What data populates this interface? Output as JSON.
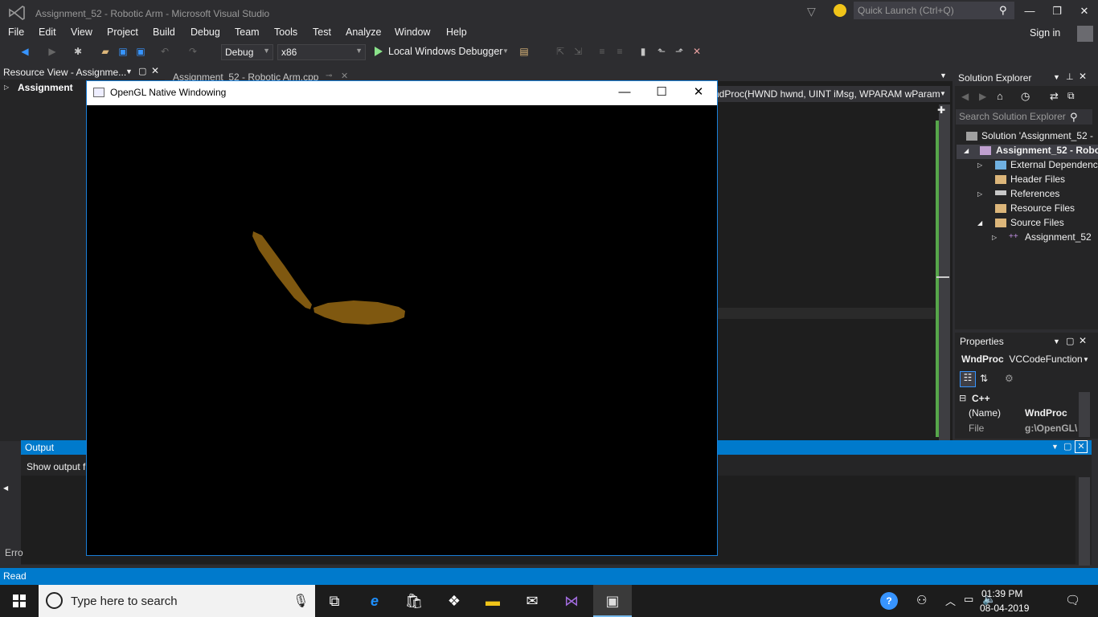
{
  "window": {
    "title": "Assignment_52 - Robotic Arm - Microsoft Visual Studio"
  },
  "quick_launch": {
    "placeholder": "Quick Launch (Ctrl+Q)"
  },
  "menu": [
    "File",
    "Edit",
    "View",
    "Project",
    "Build",
    "Debug",
    "Team",
    "Tools",
    "Test",
    "Analyze",
    "Window",
    "Help"
  ],
  "sign_in": "Sign in",
  "toolbar": {
    "config": "Debug",
    "platform": "x86",
    "debugger": "Local Windows Debugger"
  },
  "resource_view": {
    "title": "Resource View - Assignme...",
    "node": "Assignment"
  },
  "doc_tab": {
    "label": "Assignment_52 - Robotic Arm.cpp"
  },
  "nav_combo": "ndProc(HWND hwnd, UINT iMsg, WPARAM wParam",
  "solution_explorer": {
    "title": "Solution Explorer",
    "search_placeholder": "Search Solution Explorer",
    "items": [
      "Solution 'Assignment_52 -",
      "Assignment_52 - Robo",
      "External Dependenc",
      "Header Files",
      "References",
      "Resource Files",
      "Source Files",
      "Assignment_52"
    ]
  },
  "properties": {
    "title": "Properties",
    "object": "WndProc",
    "object_type": "VCCodeFunction",
    "section": "C++",
    "rows": [
      {
        "name": "(Name)",
        "value": "WndProc"
      },
      {
        "name": "File",
        "value": "g:\\OpenGL\\"
      }
    ]
  },
  "output": {
    "title": "Output",
    "show_output": "Show output f"
  },
  "error_list_label": "Erro",
  "status": "Read",
  "gl_window": {
    "title": "OpenGL Native Windowing"
  },
  "taskbar": {
    "search": "Type here to search",
    "time": "01:39 PM",
    "date": "08-04-2019"
  },
  "colors": {
    "arm": "#7f5810",
    "accent": "#007acc"
  }
}
